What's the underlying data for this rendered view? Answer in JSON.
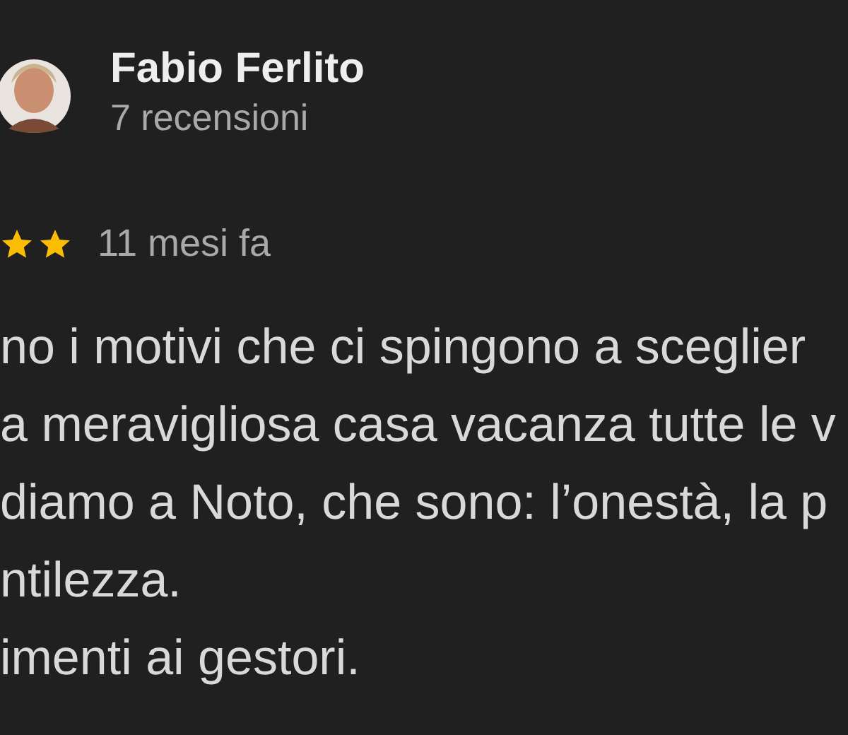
{
  "reviewer": {
    "name": "Fabio Ferlito",
    "reviews": "7 recensioni"
  },
  "rating": {
    "time": "11 mesi fa"
  },
  "lines": [
    "no i motivi che ci spingono a sceglier",
    "a meravigliosa casa vacanza tutte le v",
    "diamo a Noto, che sono: l’onestà, la p",
    "ntilezza.",
    "imenti ai gestori."
  ]
}
